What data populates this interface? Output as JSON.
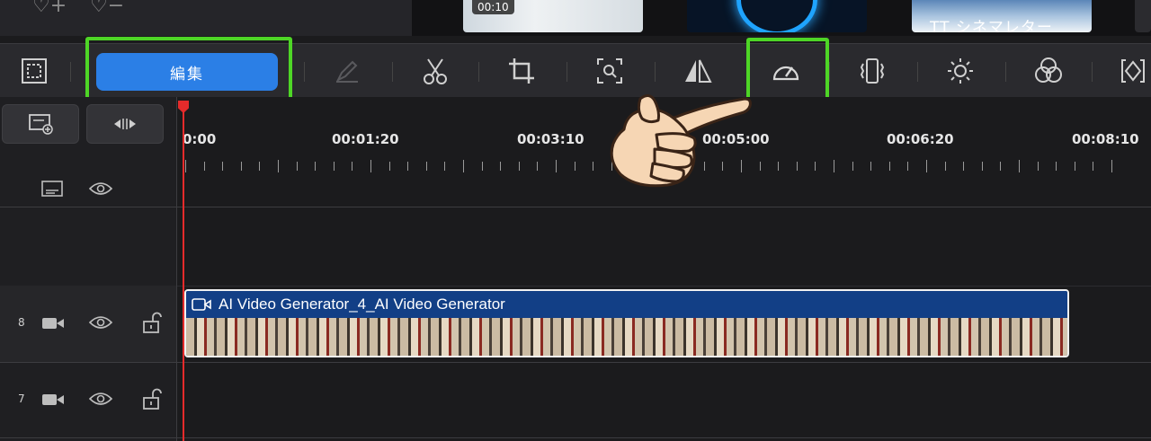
{
  "media_strip": {
    "thumb1_duration": "00:10",
    "thumb3_label": "TT シネマレター"
  },
  "toolbar": {
    "edit_label": "編集",
    "tools": [
      "frame-icon",
      "pen-icon",
      "scissors-icon",
      "crop-icon",
      "zoom-icon",
      "mirror-icon",
      "speed-icon",
      "stabilize-icon",
      "brightness-icon",
      "color-icon",
      "keyframe-icon"
    ]
  },
  "timeline": {
    "ticks": [
      "0:00",
      "00:01:20",
      "00:03:10",
      "00:05:00",
      "00:06:20",
      "00:08:10"
    ]
  },
  "tracks": [
    {
      "number": "8",
      "clip_title": "AI Video Generator_4_AI Video Generator"
    },
    {
      "number": "7"
    }
  ],
  "colors": {
    "accent": "#2b7fe6",
    "highlight": "#4ed626",
    "playhead": "#e52b2b"
  }
}
